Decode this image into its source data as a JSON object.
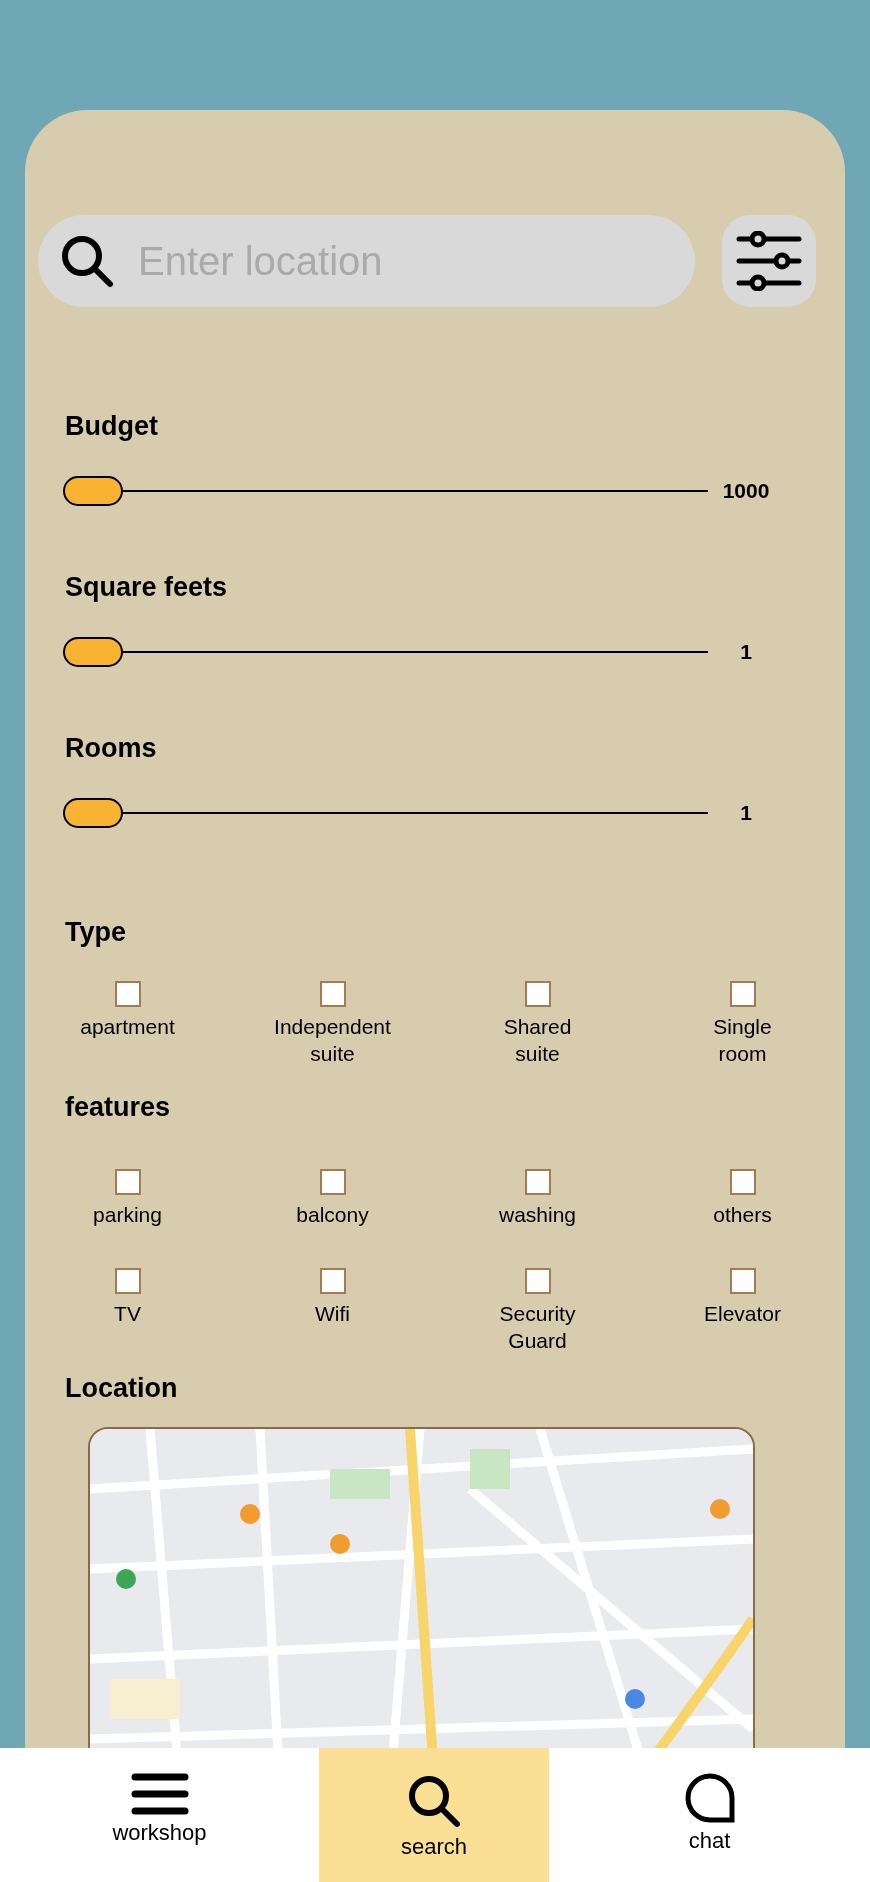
{
  "search": {
    "placeholder": "Enter location"
  },
  "sliders": [
    {
      "label": "Budget",
      "level": 0,
      "reading": "1000"
    },
    {
      "label": "Square feets",
      "level": 0,
      "reading": "1"
    },
    {
      "label": "Rooms",
      "level": 0,
      "reading": "1"
    }
  ],
  "type": {
    "title": "Type",
    "options": [
      {
        "label": "apartment",
        "checked": false
      },
      {
        "label": "Independent\nsuite",
        "checked": false
      },
      {
        "label": "Shared\nsuite",
        "checked": false
      },
      {
        "label": "Single\nroom",
        "checked": false
      }
    ]
  },
  "features": {
    "title": "features",
    "options": [
      {
        "label": "parking",
        "checked": false
      },
      {
        "label": "balcony",
        "checked": false
      },
      {
        "label": "washing",
        "checked": false
      },
      {
        "label": "others",
        "checked": false
      },
      {
        "label": "TV",
        "checked": false
      },
      {
        "label": "Wifi",
        "checked": false
      },
      {
        "label": "Security\nGuard",
        "checked": false
      },
      {
        "label": "Elevator",
        "checked": false
      }
    ]
  },
  "location": {
    "title": "Location"
  },
  "nav": [
    {
      "label": "workshop",
      "kind": "menu",
      "selected": false
    },
    {
      "label": "search",
      "kind": "search",
      "selected": true
    },
    {
      "label": "chat",
      "kind": "chat",
      "selected": false
    }
  ]
}
